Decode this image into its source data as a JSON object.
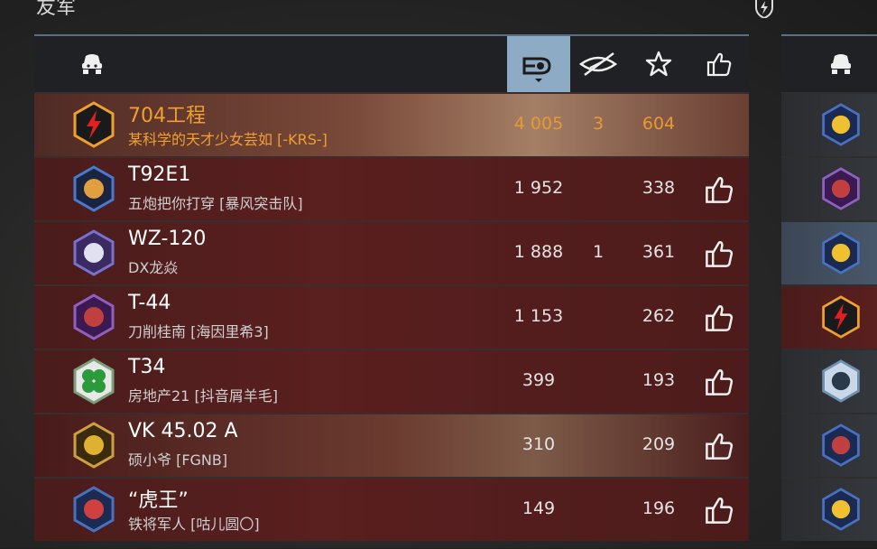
{
  "team_title": "友军",
  "colors": {
    "accent_header": "#8eabc6",
    "player_highlight": "#f0a030",
    "row_red": "#5a1f1f",
    "header_bg": "#1f2124"
  },
  "header_icons": [
    "tank-icon",
    "damage-icon",
    "spotting-icon",
    "star-icon",
    "thumbs-up-icon"
  ],
  "rows": [
    {
      "tank": "704工程",
      "player": "某科学的天才少女芸如 [-KRS-]",
      "damage": "4 005",
      "spots": "3",
      "score": "604",
      "badge": "lightning-badge",
      "is_player": true,
      "liked": false
    },
    {
      "tank": "T92E1",
      "player": "五炮把你打穿 [暴风突击队]",
      "damage": "1 952",
      "spots": "",
      "score": "338",
      "badge": "missile-badge",
      "is_player": false,
      "liked": true
    },
    {
      "tank": "WZ-120",
      "player": "DX龙焱",
      "damage": "1 888",
      "spots": "1",
      "score": "361",
      "badge": "astronaut-badge",
      "is_player": false,
      "liked": true
    },
    {
      "tank": "T-44",
      "player": "刀削桂南 [海因里希3]",
      "damage": "1 153",
      "spots": "",
      "score": "262",
      "badge": "shield-badge",
      "is_player": false,
      "liked": true
    },
    {
      "tank": "T34",
      "player": "房地产21 [抖音屑羊毛]",
      "damage": "399",
      "spots": "",
      "score": "193",
      "badge": "clover-badge",
      "is_player": false,
      "liked": true
    },
    {
      "tank": "VK 45.02 A",
      "player": "硕小爷 [FGNB]",
      "damage": "310",
      "spots": "",
      "score": "209",
      "badge": "lion-badge",
      "is_player": false,
      "liked": true
    },
    {
      "tank": "“虎王”",
      "player": "铁将军人 [咕儿圆〇]",
      "damage": "149",
      "spots": "",
      "score": "196",
      "badge": "warship-badge",
      "is_player": false,
      "liked": true
    }
  ],
  "right_badges": [
    "thumbs-badge",
    "shield-badge",
    "monkey-badge",
    "lightning-badge",
    "crossed-guns-badge",
    "shield-blue-badge",
    "monkey-badge"
  ]
}
